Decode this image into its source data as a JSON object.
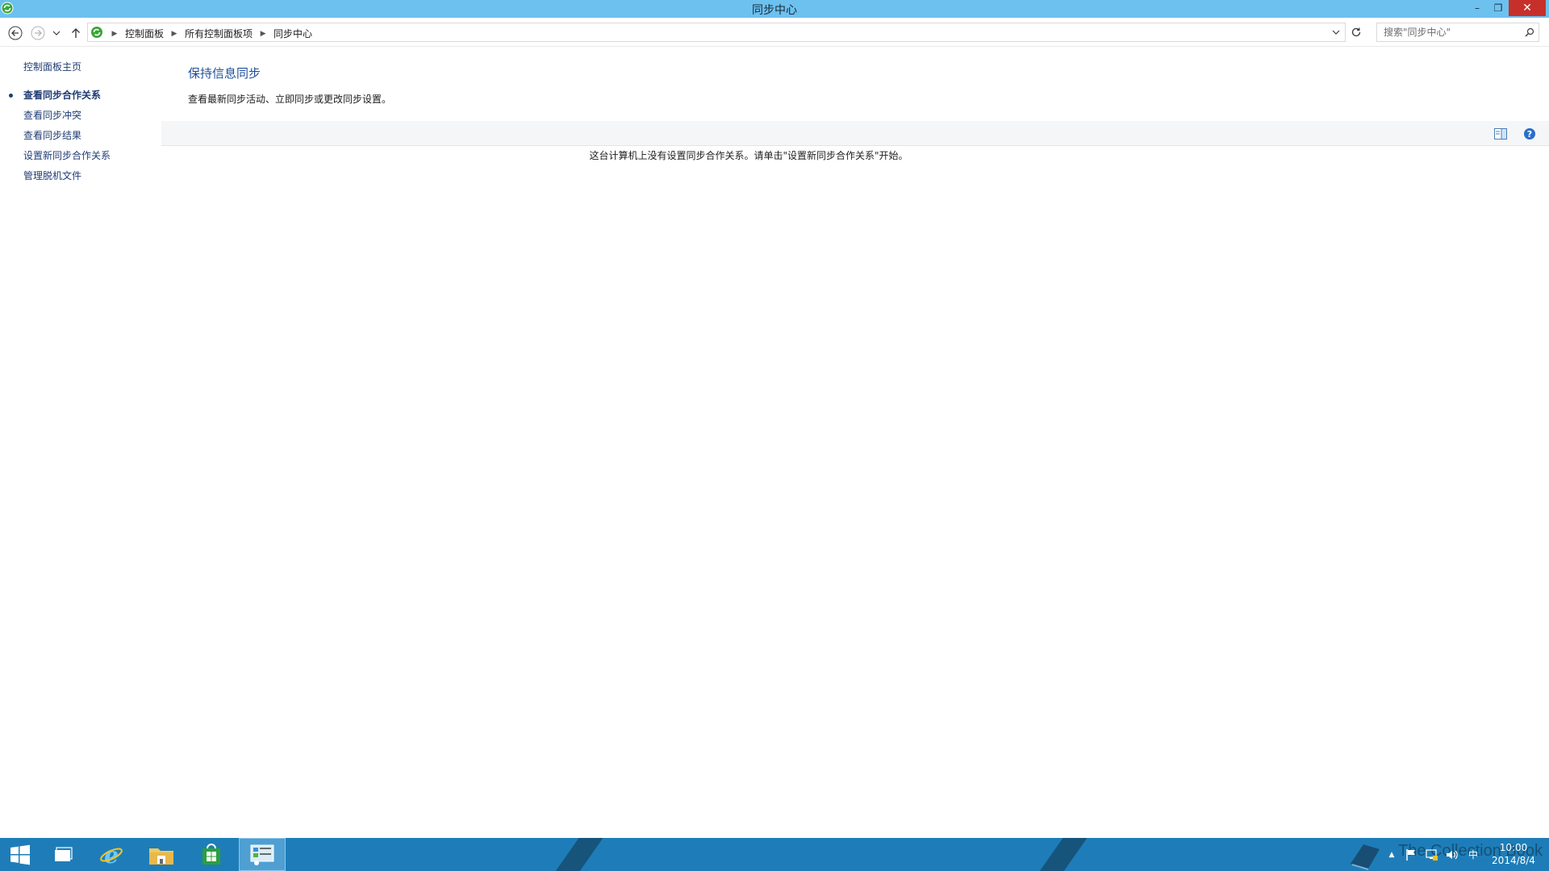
{
  "window": {
    "title": "同步中心",
    "minimize_glyph": "–",
    "maximize_glyph": "❐",
    "close_glyph": "✕"
  },
  "navbar": {
    "breadcrumbs": [
      "控制面板",
      "所有控制面板项",
      "同步中心"
    ],
    "search_placeholder": "搜索\"同步中心\""
  },
  "sidebar": {
    "home_link": "控制面板主页",
    "items": [
      {
        "label": "查看同步合作关系",
        "selected": true
      },
      {
        "label": "查看同步冲突",
        "selected": false
      },
      {
        "label": "查看同步结果",
        "selected": false
      },
      {
        "label": "设置新同步合作关系",
        "selected": false
      },
      {
        "label": "管理脱机文件",
        "selected": false
      }
    ]
  },
  "main": {
    "heading": "保持信息同步",
    "subtitle": "查看最新同步活动、立即同步或更改同步设置。",
    "empty_message": "这台计算机上没有设置同步合作关系。请单击\"设置新同步合作关系\"开始。"
  },
  "taskbar": {
    "pinned": [
      "windows-start",
      "task-view",
      "internet-explorer",
      "file-explorer",
      "store",
      "control-panel"
    ],
    "tray_ime": "中",
    "clock_time": "10:00",
    "clock_date": "2014/8/4",
    "watermark_text": "The Collection Book"
  },
  "colors": {
    "titlebar": "#6cc1ef",
    "close_button": "#c7302a",
    "link": "#1f3c74",
    "heading": "#1e4e99",
    "taskbar": "#1e7db8",
    "taskbar_stripe": "#16547c"
  }
}
